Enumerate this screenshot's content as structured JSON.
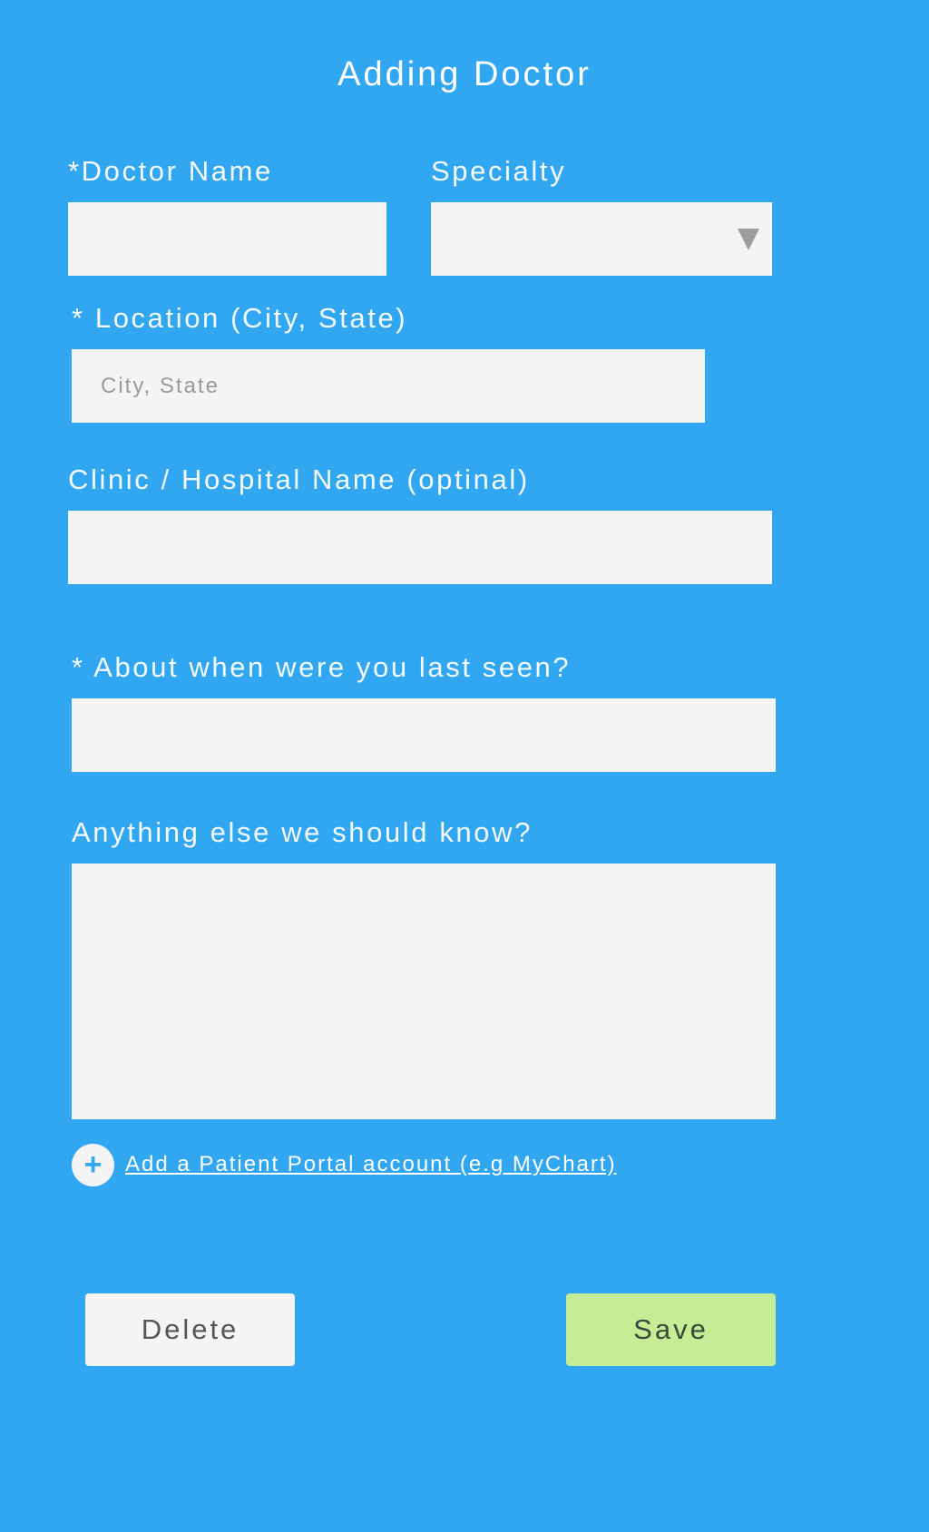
{
  "page": {
    "title": "Adding Doctor"
  },
  "form": {
    "doctor_name": {
      "label": "*Doctor Name",
      "value": ""
    },
    "specialty": {
      "label": "Specialty",
      "selected": ""
    },
    "location": {
      "label": "* Location (City, State)",
      "placeholder": "City, State",
      "value": ""
    },
    "clinic": {
      "label": "Clinic / Hospital Name  (optinal)",
      "value": ""
    },
    "last_seen": {
      "label": "* About when were you last seen?",
      "value": ""
    },
    "notes": {
      "label": "Anything else we should know?",
      "value": ""
    }
  },
  "portal": {
    "add_icon": "plus-icon",
    "add_label": "Add a Patient Portal account (e.g MyChart)"
  },
  "actions": {
    "delete_label": "Delete",
    "save_label": "Save"
  },
  "colors": {
    "background": "#30a7f0",
    "field": "#f4f4f4",
    "save": "#c5ed95",
    "text": "#ffffff"
  }
}
